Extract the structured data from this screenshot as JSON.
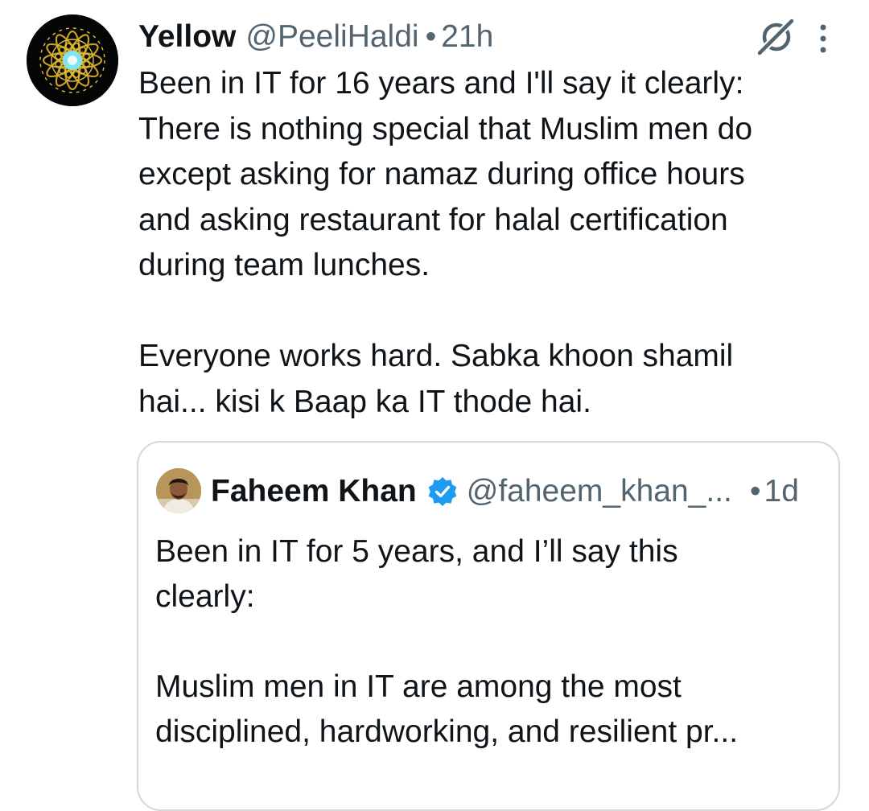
{
  "tweet": {
    "display_name": "Yellow",
    "handle": "@PeeliHaldi",
    "separator": "•",
    "time": "21h",
    "avatar_icon": "mandala-avatar",
    "lines": [
      "Been in IT for 16 years and I'll say it clearly:",
      "There is nothing special that Muslim men do",
      "except asking for namaz during office hours",
      "and asking restaurant for halal certification",
      "during team lunches."
    ],
    "lines2": [
      "Everyone works hard. Sabka khoon shamil",
      "hai... kisi k Baap ka IT thode hai."
    ]
  },
  "icons": {
    "grok": "grok-icon",
    "more": "more-vertical-icon",
    "verified": "verified-badge-icon"
  },
  "quote": {
    "display_name": "Faheem Khan",
    "handle": "@faheem_khan_...",
    "separator": "•",
    "time": "1d",
    "avatar_icon": "profile-photo-avatar",
    "lines": [
      "Been in IT for 5 years, and I’ll say this",
      "clearly:"
    ],
    "lines2": [
      "Muslim men in IT are among the most",
      "disciplined, hardworking, and resilient pr..."
    ]
  },
  "colors": {
    "text": "#0f1419",
    "secondary": "#536471",
    "border": "#cfd9de",
    "verified": "#1d9bf0"
  }
}
